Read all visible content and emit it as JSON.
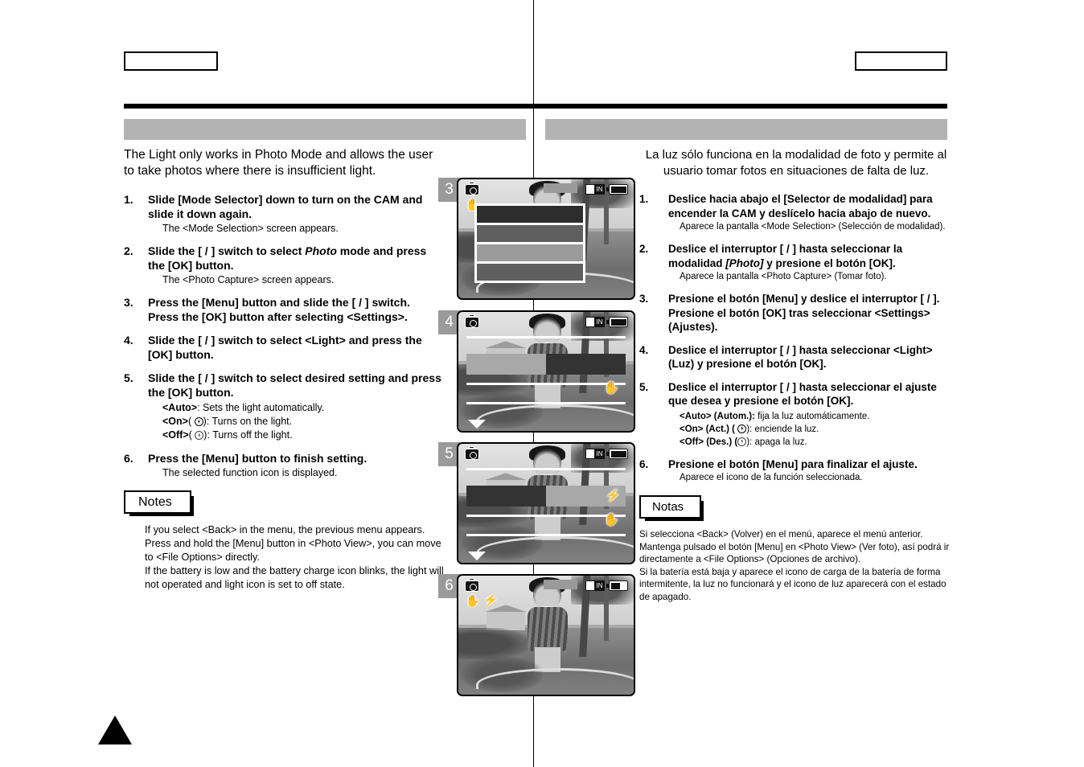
{
  "page": {
    "header_left_box": "",
    "header_right_box": "",
    "title_bar_en": "",
    "title_bar_es": "",
    "page_marker": ""
  },
  "english": {
    "intro": "The Light only works in Photo Mode and allows the user to take photos where there is insufficient light.",
    "steps": [
      {
        "num": "1.",
        "title": "Slide [Mode Selector] down to turn on the CAM and slide it down again.",
        "sub": "The <Mode Selection> screen appears."
      },
      {
        "num": "2.",
        "title_pre": "Slide the [    /    ] switch to select ",
        "title_ital": "Photo",
        "title_post": " mode and press the [OK] button.",
        "sub": "The <Photo Capture> screen appears."
      },
      {
        "num": "3.",
        "title": "Press the [Menu] button and slide the [    /    ] switch.\nPress the [OK] button after selecting <Settings>.",
        "sub": ""
      },
      {
        "num": "4.",
        "title": "Slide the [    /    ] switch to select <Light> and press the [OK] button.",
        "sub": ""
      },
      {
        "num": "5.",
        "title": "Slide the [    /    ] switch to select desired setting and press the [OK] button.",
        "sub": ""
      },
      {
        "num": "6.",
        "title": "Press the [Menu] button to finish setting.",
        "sub": "The selected function icon is displayed."
      }
    ],
    "options": [
      {
        "label": "<Auto>",
        "icon": false,
        "text": ": Sets the light automatically."
      },
      {
        "label": "<On>",
        "icon": true,
        "icon_state": "on",
        "text": ": Turns on the light."
      },
      {
        "label": "<Off>",
        "icon": true,
        "icon_state": "off",
        "text": ": Turns off the light."
      }
    ],
    "notes_tab": "Notes",
    "notes_body": "If you select <Back> in the menu, the previous menu appears.\nPress and hold the [Menu] button in <Photo View>, you can move to <File Options> directly.\nIf the battery is low and the battery charge icon blinks, the light will not operated and light icon is set to off state."
  },
  "spanish": {
    "intro": "La luz sólo funciona en la modalidad de foto y permite al usuario tomar fotos en situaciones de falta de luz.",
    "steps": [
      {
        "num": "1.",
        "title": "Deslice hacia abajo el [Selector de modalidad] para encender la CAM y deslícelo hacia abajo de nuevo.",
        "sub": "Aparece la pantalla <Mode Selection> (Selección de modalidad)."
      },
      {
        "num": "2.",
        "title_pre": "Deslice el interruptor [    /    ] hasta seleccionar la modalidad ",
        "title_ital": "[Photo]",
        "title_post": " y presione el botón [OK].",
        "sub": "Aparece la pantalla <Photo Capture> (Tomar foto)."
      },
      {
        "num": "3.",
        "title": "Presione el botón [Menu] y deslice el interruptor [    /    ].\nPresione el botón [OK] tras seleccionar <Settings> (Ajustes).",
        "sub": ""
      },
      {
        "num": "4.",
        "title": "Deslice el interruptor [    /    ] hasta seleccionar <Light> (Luz) y presione el botón [OK].",
        "sub": ""
      },
      {
        "num": "5.",
        "title": "Deslice el interruptor [    /    ] hasta seleccionar el ajuste que desea y presione el botón [OK].",
        "sub": ""
      },
      {
        "num": "6.",
        "title": "Presione el botón [Menu] para finalizar el ajuste.",
        "sub": "Aparece el icono de la función seleccionada."
      }
    ],
    "options": [
      {
        "label": "<Auto> (Autom.):",
        "icon": false,
        "text": " fija la luz automáticamente."
      },
      {
        "label": "<On> (Act.) (",
        "icon": true,
        "icon_state": "on",
        "text": "): enciende la luz."
      },
      {
        "label": "<Off> (Des.) (",
        "icon": true,
        "icon_state": "off",
        "text": "): apaga la luz."
      }
    ],
    "notes_tab": "Notas",
    "notes_body": "Si selecciona <Back> (Volver) en el menú, aparece el menú anterior.\nMantenga pulsado el botón [Menu] en <Photo View> (Ver foto), así podrá ir directamente a <File Options> (Opciones de archivo).\nSi la batería está baja y aparece el icono de carga de la batería de forma intermitente, la luz no funcionará y el icono de luz aparecerá con el estado de apagado."
  },
  "screenshots": [
    {
      "badge": "3",
      "kind": "vertical-menu",
      "osd": {
        "camera_icon": "camera-mode-icon",
        "hand_icon": "hand-stabilizer-icon",
        "memory": "IN",
        "battery": "full",
        "title_blob": true
      },
      "menu_rows": [
        "",
        "",
        "",
        ""
      ],
      "selected_row": 0
    },
    {
      "badge": "4",
      "kind": "horizontal-list",
      "osd": {
        "camera_icon": "camera-mode-icon",
        "memory": "IN",
        "battery": "full",
        "stabilizer_icon": "hand-stabilizer-icon"
      },
      "selected_side": "right",
      "has_down_arrow": true
    },
    {
      "badge": "5",
      "kind": "horizontal-list",
      "osd": {
        "camera_icon": "camera-mode-icon",
        "memory": "IN",
        "battery": "full",
        "stabilizer_icon": "hand-stabilizer-icon",
        "flash_icon": "flash-icon"
      },
      "selected_side": "left",
      "has_down_arrow": true
    },
    {
      "badge": "6",
      "kind": "preview",
      "osd": {
        "camera_icon": "camera-mode-icon",
        "hand_icon": "hand-stabilizer-icon",
        "flash_icon": "flash-icon",
        "memory": "IN",
        "battery": "low",
        "title_blob": true
      }
    }
  ],
  "colors": {
    "title_bar": "#b3b3b3",
    "badge": "#9a9a9a",
    "rule": "#000000"
  }
}
